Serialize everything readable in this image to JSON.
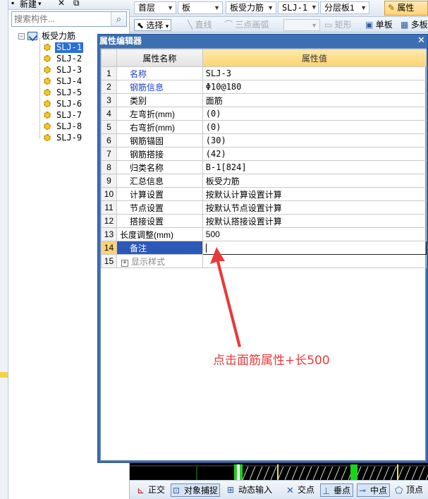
{
  "left_toolbar": {
    "new_label": "新建",
    "delete_icon": "close-icon",
    "copy_icon": "copy-icon"
  },
  "search": {
    "placeholder": "搜索构件..."
  },
  "tree": {
    "root_label": "板受力筋",
    "items": [
      "SLJ-1",
      "SLJ-2",
      "SLJ-3",
      "SLJ-4",
      "SLJ-5",
      "SLJ-6",
      "SLJ-7",
      "SLJ-8",
      "SLJ-9"
    ],
    "selected_index": 0
  },
  "toolbar1": {
    "floor": "首层",
    "category": "板",
    "type": "板受力筋",
    "component": "SLJ-1",
    "layer": "分层板1",
    "property_button": "属性"
  },
  "toolbar2": {
    "select": "选择",
    "line": "直线",
    "arc": "三点画弧",
    "rect": "矩形",
    "single_board": "单板",
    "multi_board": "多板"
  },
  "dialog": {
    "title": "属性编辑器",
    "col_name": "属性名称",
    "col_value": "属性值",
    "rows": [
      {
        "num": "1",
        "name": "名称",
        "value": "SLJ-3"
      },
      {
        "num": "2",
        "name": "钢筋信息",
        "value": "Φ10@180"
      },
      {
        "num": "3",
        "name": "类别",
        "value": "面筋"
      },
      {
        "num": "4",
        "name": "左弯折(mm)",
        "value": "(0)"
      },
      {
        "num": "5",
        "name": "右弯折(mm)",
        "value": "(0)"
      },
      {
        "num": "6",
        "name": "钢筋锚固",
        "value": "(30)"
      },
      {
        "num": "7",
        "name": "钢筋搭接",
        "value": "(42)"
      },
      {
        "num": "8",
        "name": "归类名称",
        "value": "B-1[824]"
      },
      {
        "num": "9",
        "name": "汇总信息",
        "value": "板受力筋"
      },
      {
        "num": "10",
        "name": "计算设置",
        "value": "按默认计算设置计算"
      },
      {
        "num": "11",
        "name": "节点设置",
        "value": "按默认节点设置计算"
      },
      {
        "num": "12",
        "name": "搭接设置",
        "value": "按默认搭接设置计算"
      },
      {
        "num": "13",
        "name": "长度调整(mm)",
        "value": "500"
      },
      {
        "num": "14",
        "name": "备注",
        "value": ""
      },
      {
        "num": "15",
        "name": "显示样式",
        "value": ""
      }
    ],
    "selected_row": 14
  },
  "annotation": {
    "text": "点击面筋属性+长500",
    "color": "#e8393a"
  },
  "status_bar": {
    "ortho": "正交",
    "snap": "对象捕捉",
    "dynamic_input": "动态输入",
    "intersection": "交点",
    "perpendicular": "垂点",
    "midpoint": "中点",
    "vertex": "顶点"
  },
  "colors": {
    "selection_blue": "#2c59b7",
    "header_gold": "#fcd36f",
    "title_blue": "#3c6fb1"
  }
}
